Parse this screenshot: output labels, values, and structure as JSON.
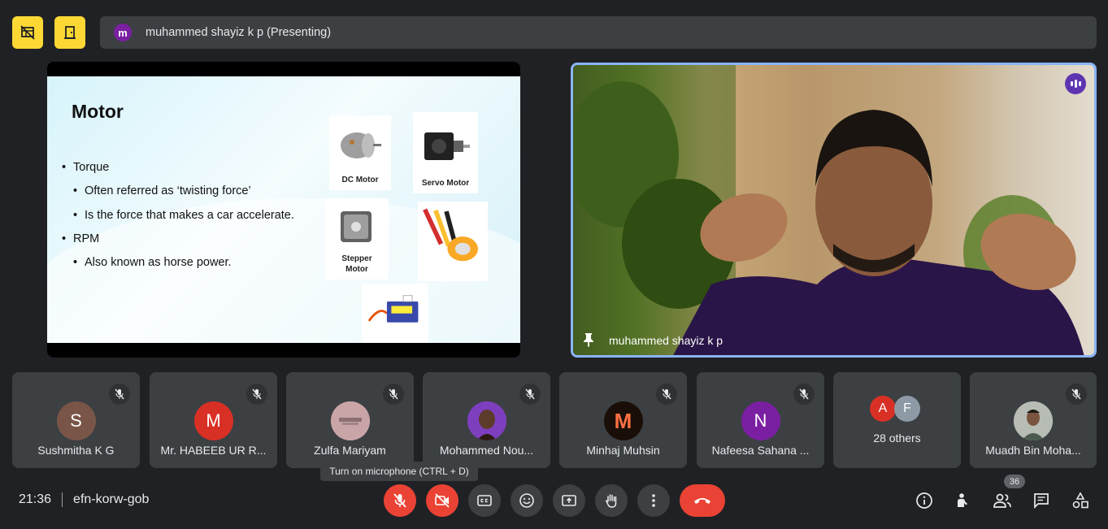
{
  "presenter_bar": {
    "avatar_letter": "m",
    "text": "muhammed shayiz k p (Presenting)"
  },
  "slide": {
    "title": "Motor",
    "bullets": [
      {
        "text": "Torque",
        "level": 1
      },
      {
        "text": "Often referred as ‘twisting force’",
        "level": 2
      },
      {
        "text": "Is the force that makes a car accelerate.",
        "level": 2
      },
      {
        "text": "RPM",
        "level": 1
      },
      {
        "text": "Also known as horse power.",
        "level": 2
      }
    ],
    "images": [
      "DC Motor",
      "Servo Motor",
      "Stepper Motor"
    ]
  },
  "main_camera": {
    "name": "muhammed shayiz k p"
  },
  "participants": [
    {
      "name": "Sushmitha K G",
      "letter": "S",
      "color": "#795548"
    },
    {
      "name": "Mr. HABEEB UR R...",
      "letter": "M",
      "color": "#d93025"
    },
    {
      "name": "Zulfa Mariyam",
      "letter": "",
      "color": "#c9a5a8"
    },
    {
      "name": "Mohammed Nou...",
      "letter": "",
      "color": "#7e3fbf"
    },
    {
      "name": "Minhaj Muhsin",
      "letter": "M",
      "color": "#1a0f08"
    },
    {
      "name": "Nafeesa Sahana ...",
      "letter": "N",
      "color": "#7b1fa2"
    }
  ],
  "others": {
    "letters": [
      "A",
      "F"
    ],
    "label": "28 others"
  },
  "last_participant": {
    "name": "Muadh Bin Moha..."
  },
  "tooltip": "Turn on microphone (CTRL + D)",
  "bottom": {
    "time": "21:36",
    "meeting_code": "efn-korw-gob",
    "participant_count": "36"
  }
}
